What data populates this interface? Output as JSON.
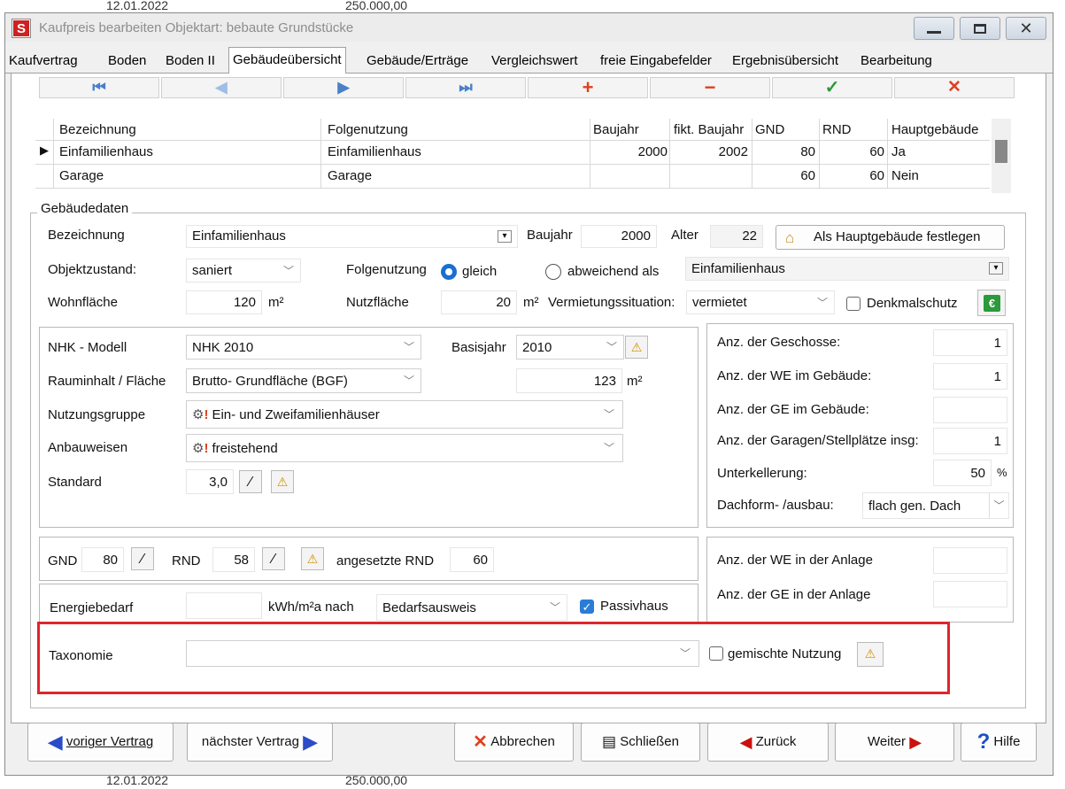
{
  "background_rows": {
    "top_date": "12.01.2022",
    "top_amount": "250.000,00",
    "bottom_date": "12.01.2022",
    "bottom_amount": "250.000,00"
  },
  "window": {
    "app_icon_letter": "S",
    "title": "Kaufpreis bearbeiten  Objektart: bebaute Grundstücke"
  },
  "tabs": [
    "Kaufvertrag",
    "Boden",
    "Boden II",
    "Gebäudeübersicht",
    "Gebäude/Erträge",
    "Vergleichswert",
    "freie Eingabefelder",
    "Ergebnisübersicht",
    "Bearbeitung"
  ],
  "navigator": {
    "first": "⏮",
    "prev": "◀",
    "next": "▶",
    "last": "⏭",
    "add": "+",
    "delete": "−",
    "confirm": "✓",
    "cancel": "✕"
  },
  "grid": {
    "columns": [
      "Bezeichnung",
      "Folgenutzung",
      "Baujahr",
      "fikt. Baujahr",
      "GND",
      "RND",
      "Hauptgebäude"
    ],
    "rows": [
      {
        "bezeichnung": "Einfamilienhaus",
        "folgenutzung": "Einfamilienhaus",
        "baujahr": "2000",
        "fikt_baujahr": "2002",
        "gnd": "80",
        "rnd": "60",
        "haupt": "Ja"
      },
      {
        "bezeichnung": "Garage",
        "folgenutzung": "Garage",
        "baujahr": "",
        "fikt_baujahr": "",
        "gnd": "60",
        "rnd": "60",
        "haupt": "Nein"
      }
    ]
  },
  "gebaeudedaten": {
    "group_label": "Gebäudedaten",
    "bezeichnung_label": "Bezeichnung",
    "bezeichnung": "Einfamilienhaus",
    "baujahr_label": "Baujahr",
    "baujahr": "2000",
    "alter_label": "Alter",
    "alter": "22",
    "hauptgebaeude_button": "Als Hauptgebäude festlegen",
    "objektzustand_label": "Objektzustand:",
    "objektzustand": "saniert",
    "folgenutzung_label": "Folgenutzung",
    "radio_gleich": "gleich",
    "radio_abweichend": "abweichend  als",
    "folgenutzung_value": "Einfamilienhaus",
    "wohnflaeche_label": "Wohnfläche",
    "wohnflaeche": "120",
    "unit_m2": "m²",
    "nutzflaeche_label": "Nutzfläche",
    "nutzflaeche": "20",
    "vermietung_label": "Vermietungssituation:",
    "vermietung": "vermietet",
    "denkmalschutz_label": "Denkmalschutz",
    "euro_icon": "€"
  },
  "nhk": {
    "modell_label": "NHK - Modell",
    "modell": "NHK 2010",
    "basisjahr_label": "Basisjahr",
    "basisjahr": "2010",
    "rauminhalt_label": "Rauminhalt / Fläche",
    "rauminhalt": "Brutto- Grundfläche (BGF)",
    "flaeche": "123",
    "nutzungsgruppe_label": "Nutzungsgruppe",
    "nutzungsgruppe": "Ein- und Zweifamilienhäuser",
    "anbauweisen_label": "Anbauweisen",
    "anbauweisen": "freistehend",
    "standard_label": "Standard",
    "standard": "3,0"
  },
  "right_panel": {
    "geschosse_label": "Anz. der Geschosse:",
    "geschosse": "1",
    "we_label": "Anz. der WE im Gebäude:",
    "we": "1",
    "ge_label": "Anz. der GE im Gebäude:",
    "ge": "",
    "garagen_label": "Anz. der Garagen/Stellplätze insg:",
    "garagen": "1",
    "unterkellerung_label": "Unterkellerung:",
    "unterkellerung": "50",
    "percent": "%",
    "dachform_label": "Dachform- /ausbau:",
    "dachform": "flach gen. Dach",
    "we_anlage_label": "Anz. der WE in der Anlage",
    "we_anlage": "",
    "ge_anlage_label": "Anz. der GE in der Anlage",
    "ge_anlage": ""
  },
  "gnd_row": {
    "gnd_label": "GND",
    "gnd": "80",
    "rnd_label": "RND",
    "rnd": "58",
    "angesetzt_label": "angesetzte RND",
    "angesetzt": "60"
  },
  "energie": {
    "label": "Energiebedarf",
    "value": "",
    "unit": "kWh/m²a  nach",
    "nach": "Bedarfsausweis",
    "passivhaus_label": "Passivhaus"
  },
  "taxonomie": {
    "label": "Taxonomie",
    "value": "",
    "gemischt_label": "gemischte Nutzung"
  },
  "footer": {
    "prev": "voriger Vertrag",
    "next": "nächster Vertrag",
    "abbrechen": "Abbrechen",
    "schliessen": "Schließen",
    "zurueck": "Zurück",
    "weiter": "Weiter",
    "hilfe": "Hilfe"
  },
  "colors": {
    "accent": "#1a6fd1",
    "highlight": "#e0242e",
    "nav_blue": "#4a7fc9",
    "add_red": "#e04020",
    "ok_green": "#2a9a3a"
  }
}
